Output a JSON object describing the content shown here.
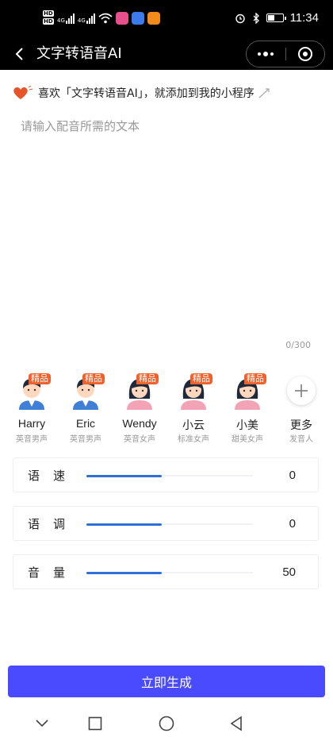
{
  "status_bar": {
    "time": "11:34",
    "hd1": "HD",
    "hd2": "HD",
    "net1": "4G",
    "net2": "4G"
  },
  "nav": {
    "title": "文字转语音AI",
    "back_icon": "chevron-left-icon",
    "menu_icon": "more-dots-icon",
    "close_icon": "target-circle-icon"
  },
  "banner": {
    "text": "喜欢「文字转语音AI」，就添加到我的小程序"
  },
  "input": {
    "placeholder": "请输入配音所需的文本",
    "value": "",
    "count": "0/300"
  },
  "colors": {
    "accent": "#4a4aff",
    "badge": "#f0602a",
    "slider": "#2f6fd8"
  },
  "voices": [
    {
      "name": "Harry",
      "desc": "英音男声",
      "badge": "精品",
      "gender": "male"
    },
    {
      "name": "Eric",
      "desc": "英音男声",
      "badge": "精品",
      "gender": "male"
    },
    {
      "name": "Wendy",
      "desc": "英音女声",
      "badge": "精品",
      "gender": "female"
    },
    {
      "name": "小云",
      "desc": "标准女声",
      "badge": "精品",
      "gender": "female"
    },
    {
      "name": "小美",
      "desc": "甜美女声",
      "badge": "精品",
      "gender": "female"
    }
  ],
  "more_voices": {
    "name": "更多",
    "desc": "发音人",
    "icon": "plus-icon"
  },
  "settings": [
    {
      "label": "语速",
      "value": "0",
      "level": 0.45
    },
    {
      "label": "语调",
      "value": "0",
      "level": 0.45
    },
    {
      "label": "音量",
      "value": "50",
      "level": 0.45
    }
  ],
  "generate": {
    "label": "立即生成"
  }
}
